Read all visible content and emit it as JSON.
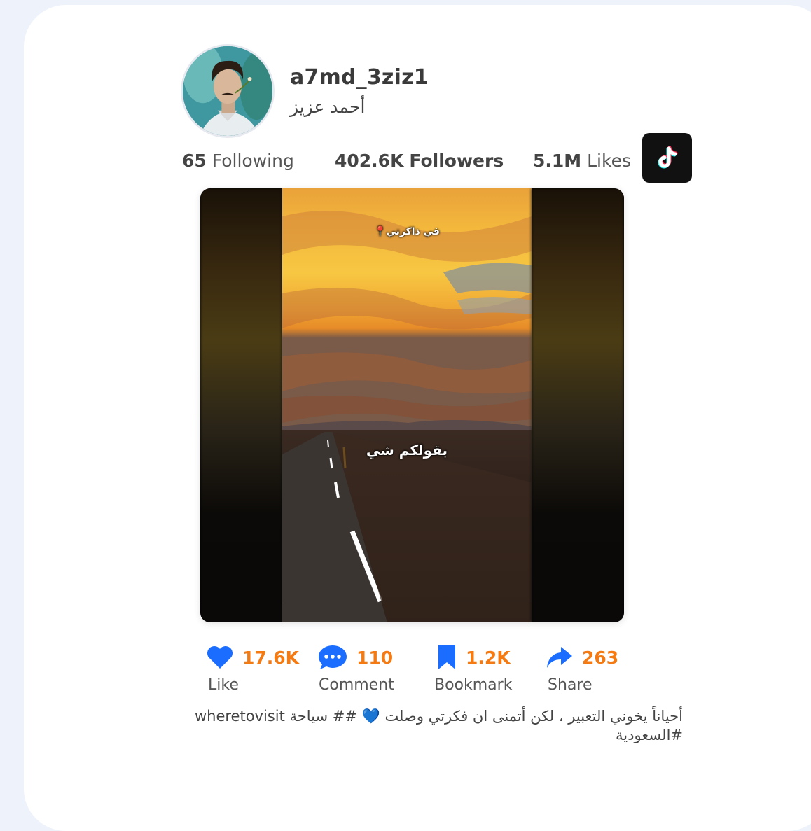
{
  "profile": {
    "username": "a7md_3ziz1",
    "display_name": "أحمد عزيز",
    "avatar_icon": "profile-avatar"
  },
  "stats": {
    "following_count": "65",
    "following_label": "Following",
    "followers_count": "402.6K",
    "followers_label": "Followers",
    "likes_count": "5.1M",
    "likes_label": "Likes"
  },
  "brand": {
    "logo_icon": "tiktok-logo-icon"
  },
  "video": {
    "overlay_top": "في ذاكرتي📍",
    "overlay_middle": "بقولكم شي"
  },
  "actions": [
    {
      "icon": "heart-icon",
      "count": "17.6K",
      "label": "Like"
    },
    {
      "icon": "comment-icon",
      "count": "110",
      "label": "Comment"
    },
    {
      "icon": "bookmark-icon",
      "count": "1.2K",
      "label": "Bookmark"
    },
    {
      "icon": "share-icon",
      "count": "263",
      "label": "Share"
    }
  ],
  "caption": "أحياناً يخوني التعبير ، لكن أتمنى ان فكرتي وصلت 💙 ## سياحة wheretovisit #السعودية",
  "colors": {
    "accent": "#f47a13",
    "icon_blue": "#1a6dff",
    "background": "#eef2fb"
  }
}
